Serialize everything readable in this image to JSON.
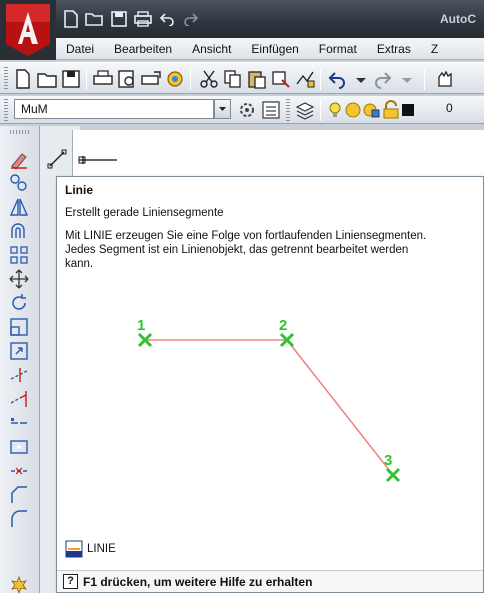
{
  "titlebar": {
    "title": "AutoC"
  },
  "menubar": {
    "items": [
      "Datei",
      "Bearbeiten",
      "Ansicht",
      "Einfügen",
      "Format",
      "Extras",
      "Z"
    ]
  },
  "toolbar_layers": {
    "layer_name": "MuM",
    "current_value": "0"
  },
  "tooltip": {
    "title": "Linie",
    "summary": "Erstellt gerade Liniensegmente",
    "description_lines": [
      "Mit LINIE erzeugen Sie eine Folge von fortlaufenden Liniensegmenten.",
      "Jedes Segment ist ein Linienobjekt, das getrennt bearbeitet werden",
      "kann."
    ],
    "illustration_points": [
      "1",
      "2",
      "3"
    ],
    "command": "LINIE",
    "help_key": "?",
    "help_text": "F1 drücken, um weitere Hilfe zu erhalten"
  },
  "colors": {
    "accent_red": "#c81818",
    "point_green": "#2fc42f",
    "line_pink": "#f08080"
  },
  "icons": [
    "autocad-logo",
    "new-icon",
    "open-icon",
    "save-icon",
    "print-icon",
    "undo-icon",
    "redo-icon",
    "line-icon",
    "help-icon"
  ]
}
